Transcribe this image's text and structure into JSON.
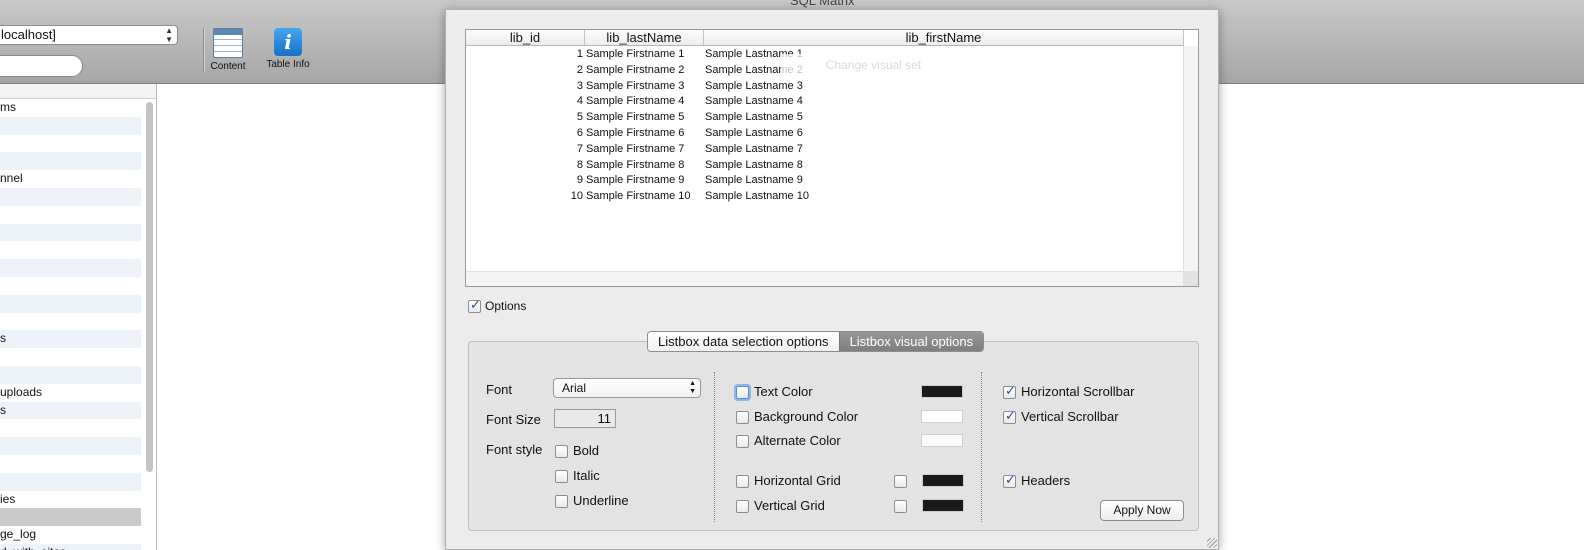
{
  "window": {
    "title": "SQL Matrix"
  },
  "toolbar": {
    "database_select": "localhost]",
    "buttons": [
      {
        "label": "Content",
        "icon": "table-grid-icon"
      },
      {
        "label": "Table Info",
        "icon": "info-icon"
      }
    ]
  },
  "sidebar": {
    "items": [
      "ms",
      "",
      "",
      "",
      "nnel",
      "",
      "",
      "",
      "",
      "",
      "",
      "",
      "",
      "s",
      "",
      "",
      "uploads",
      "s",
      "",
      "",
      "",
      "",
      "ies",
      "",
      "ge_log",
      "d_with_sites"
    ],
    "selected_index": 23
  },
  "listbox": {
    "columns": [
      "lib_id",
      "lib_lastName",
      "lib_firstName"
    ],
    "rows": [
      [
        "1",
        "Sample Firstname 1",
        "Sample Lastname 1"
      ],
      [
        "2",
        "Sample Firstname 2",
        "Sample Lastname 2"
      ],
      [
        "3",
        "Sample Firstname 3",
        "Sample Lastname 3"
      ],
      [
        "4",
        "Sample Firstname 4",
        "Sample Lastname 4"
      ],
      [
        "5",
        "Sample Firstname 5",
        "Sample Lastname 5"
      ],
      [
        "6",
        "Sample Firstname 6",
        "Sample Lastname 6"
      ],
      [
        "7",
        "Sample Firstname 7",
        "Sample Lastname 7"
      ],
      [
        "8",
        "Sample Firstname 8",
        "Sample Lastname 8"
      ],
      [
        "9",
        "Sample Firstname 9",
        "Sample Lastname 9"
      ],
      [
        "10",
        "Sample Firstname 10",
        "Sample Lastname 10"
      ]
    ],
    "ghost_button": "Change visual set"
  },
  "options": {
    "label": "Options",
    "checked": true
  },
  "tabs": [
    {
      "label": "Listbox data selection options",
      "active": false
    },
    {
      "label": "Listbox visual options",
      "active": true
    }
  ],
  "visual": {
    "font_label": "Font",
    "font_value": "Arial",
    "font_size_label": "Font Size",
    "font_size_value": "11",
    "font_style_label": "Font style",
    "styles": [
      {
        "label": "Bold",
        "checked": false
      },
      {
        "label": "Italic",
        "checked": false
      },
      {
        "label": "Underline",
        "checked": false
      }
    ],
    "colors": [
      {
        "label": "Text Color",
        "checked": false,
        "swatch": "#1a1a1a"
      },
      {
        "label": "Background Color",
        "checked": false,
        "swatch": "#ffffff"
      },
      {
        "label": "Alternate Color",
        "checked": false,
        "swatch": "#fafafa"
      }
    ],
    "grids": [
      {
        "label": "Horizontal Grid",
        "checked": false,
        "swatch": "#1a1a1a"
      },
      {
        "label": "Vertical Grid",
        "checked": false,
        "swatch": "#1a1a1a"
      }
    ],
    "scrollbars": [
      {
        "label": "Horizontal Scrollbar",
        "checked": true
      },
      {
        "label": "Vertical Scrollbar",
        "checked": true
      }
    ],
    "headers": {
      "label": "Headers",
      "checked": true
    },
    "apply_label": "Apply Now"
  }
}
